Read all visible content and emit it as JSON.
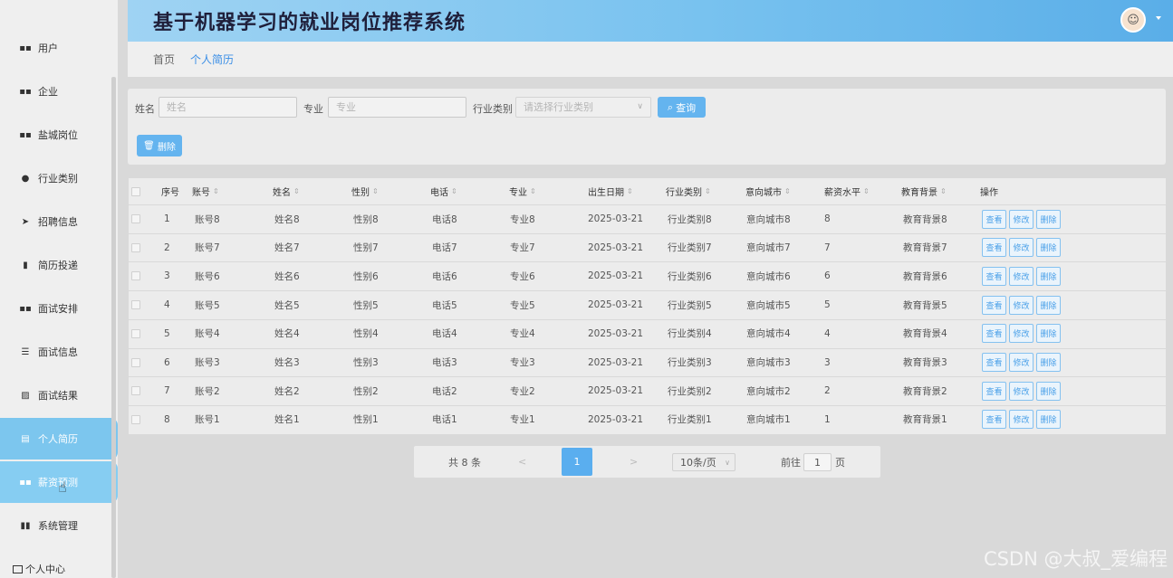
{
  "app": {
    "title": "基于机器学习的就业岗位推荐系统"
  },
  "sidebar": {
    "items": [
      {
        "label": "用户",
        "icon": "grid-icon"
      },
      {
        "label": "企业",
        "icon": "grid-icon"
      },
      {
        "label": "盐城岗位",
        "icon": "grid-icon"
      },
      {
        "label": "行业类别",
        "icon": "location-pin-icon"
      },
      {
        "label": "招聘信息",
        "icon": "paper-plane-icon"
      },
      {
        "label": "简历投递",
        "icon": "bar-chart-icon"
      },
      {
        "label": "面试安排",
        "icon": "grid-icon"
      },
      {
        "label": "面试信息",
        "icon": "sliders-icon"
      },
      {
        "label": "面试结果",
        "icon": "line-chart-icon"
      },
      {
        "label": "个人简历",
        "icon": "document-icon"
      },
      {
        "label": "薪资预测",
        "icon": "grid-icon"
      },
      {
        "label": "系统管理",
        "icon": "columns-icon"
      }
    ],
    "active_index": 9,
    "hover_index": 10,
    "bottom_label": "个人中心"
  },
  "breadcrumb": {
    "home": "首页",
    "current": "个人简历"
  },
  "search": {
    "name_label": "姓名",
    "name_placeholder": "姓名",
    "major_label": "专业",
    "major_placeholder": "专业",
    "industry_label": "行业类别",
    "industry_placeholder": "请选择行业类别",
    "query_button": "查询",
    "delete_button": "删除"
  },
  "table": {
    "headers": [
      "序号",
      "账号",
      "姓名",
      "性别",
      "电话",
      "专业",
      "出生日期",
      "行业类别",
      "意向城市",
      "薪资水平",
      "教育背景",
      "操作"
    ],
    "rows": [
      [
        "1",
        "账号8",
        "姓名8",
        "性别8",
        "电话8",
        "专业8",
        "2025-03-21",
        "行业类别8",
        "意向城市8",
        "8",
        "教育背景8"
      ],
      [
        "2",
        "账号7",
        "姓名7",
        "性别7",
        "电话7",
        "专业7",
        "2025-03-21",
        "行业类别7",
        "意向城市7",
        "7",
        "教育背景7"
      ],
      [
        "3",
        "账号6",
        "姓名6",
        "性别6",
        "电话6",
        "专业6",
        "2025-03-21",
        "行业类别6",
        "意向城市6",
        "6",
        "教育背景6"
      ],
      [
        "4",
        "账号5",
        "姓名5",
        "性别5",
        "电话5",
        "专业5",
        "2025-03-21",
        "行业类别5",
        "意向城市5",
        "5",
        "教育背景5"
      ],
      [
        "5",
        "账号4",
        "姓名4",
        "性别4",
        "电话4",
        "专业4",
        "2025-03-21",
        "行业类别4",
        "意向城市4",
        "4",
        "教育背景4"
      ],
      [
        "6",
        "账号3",
        "姓名3",
        "性别3",
        "电话3",
        "专业3",
        "2025-03-21",
        "行业类别3",
        "意向城市3",
        "3",
        "教育背景3"
      ],
      [
        "7",
        "账号2",
        "姓名2",
        "性别2",
        "电话2",
        "专业2",
        "2025-03-21",
        "行业类别2",
        "意向城市2",
        "2",
        "教育背景2"
      ],
      [
        "8",
        "账号1",
        "姓名1",
        "性别1",
        "电话1",
        "专业1",
        "2025-03-21",
        "行业类别1",
        "意向城市1",
        "1",
        "教育背景1"
      ]
    ],
    "actions": [
      "查看",
      "修改",
      "删除"
    ]
  },
  "pagination": {
    "total": "共 8 条",
    "prev": "<",
    "current_page": "1",
    "next": ">",
    "page_size": "10条/页",
    "goto_label": "前往",
    "goto_value": "1",
    "page_suffix": "页"
  },
  "watermark": "CSDN @大叔_爱编程",
  "colors": {
    "accent": "#64b4ef",
    "header_start": "#9fd3f3",
    "header_end": "#5aaee8",
    "active_nav": "#7cc6ee"
  }
}
